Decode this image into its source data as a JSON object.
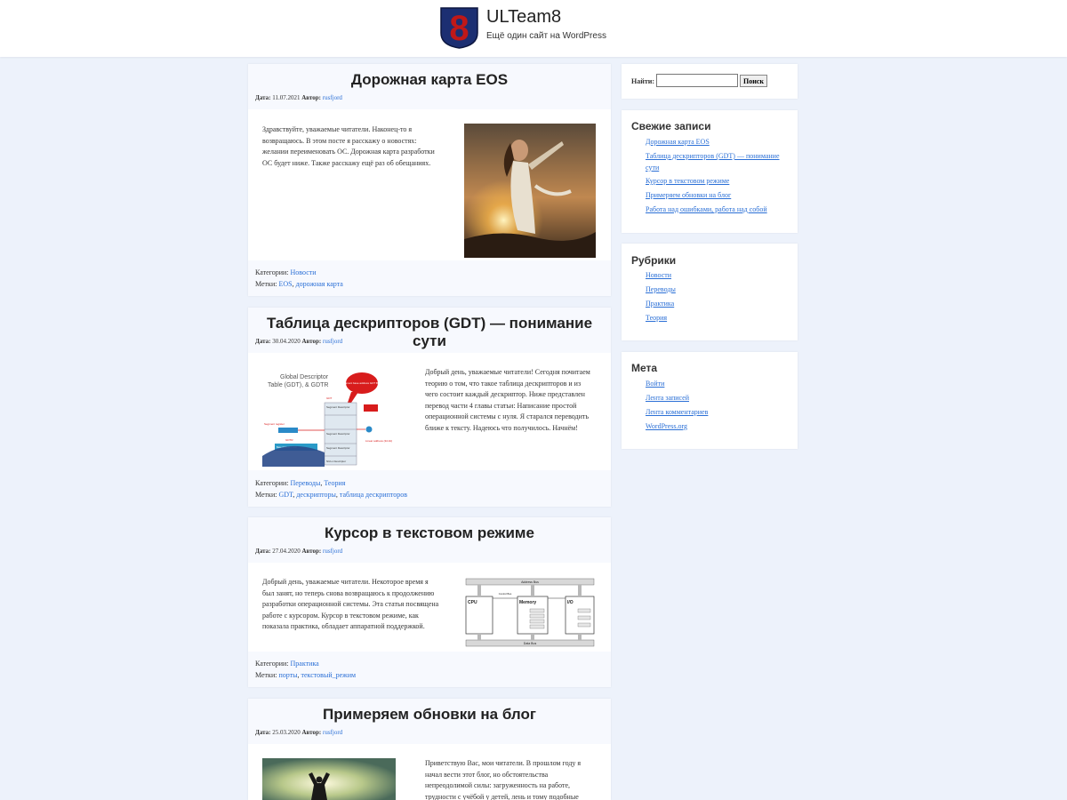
{
  "header": {
    "site_title": "ULTeam8",
    "site_description": "Ещё один сайт на WordPress",
    "logo_char": "8"
  },
  "labels": {
    "date": "Дата:",
    "author": "Автор:",
    "categories": "Категории:",
    "tags": "Метки:"
  },
  "posts": [
    {
      "title": "Дорожная карта EOS",
      "date": "11.07.2021",
      "author": "rusfjord",
      "excerpt": "Здравствуйте, уважаемые читатели. Наконец-то я возвращаюсь. В этом посте я расскажу о новостях: желании переименовать ОС. Дорожная карта разработки ОС будет ниже. Также расскажу ещё раз об обещаниях.",
      "categories": [
        "Новости"
      ],
      "tags": [
        "EOS",
        "дорожная карта"
      ]
    },
    {
      "title": "Таблица дескрипторов (GDT) — понимание сути",
      "date": "30.04.2020",
      "author": "rusfjord",
      "excerpt": "Добрый день, уважаемые читатели! Сегодня почитаем теорию о том, что такое таблица дескрипторов и из чего состоит каждый дескриптор. Ниже представлен перевод части 4 главы статьи: Написание простой операционной системы с нуля. Я старался переводить ближе к тексту. Надеюсь что получилось. Начнём!",
      "categories": [
        "Переводы",
        "Теория"
      ],
      "tags": [
        "GDT",
        "дескрипторы",
        "таблица дескрипторов"
      ],
      "diagram": {
        "title_line1": "Global Descriptor",
        "title_line2": "Table (GDT), & GDTR",
        "bubble": "Segment base address GDT Base",
        "gdt": "GDT",
        "gdtr": "GDTR",
        "segment_register": "Segment register",
        "segment_descriptor": "Segment Descriptor",
        "null_descriptor": "NULL Descriptor",
        "linear_address": "Linear address (32-bit)",
        "base_address": "Base Address | Limit",
        "offset": "Offset"
      }
    },
    {
      "title": "Курсор в текстовом режиме",
      "date": "27.04.2020",
      "author": "rusfjord",
      "excerpt": "Добрый день, уважаемые читатели. Некоторое время я был занят, но теперь снова возвращаюсь к продолжению разработки операционной системы. Эта статья посвящена работе с курсором. Курсор в текстовом режиме, как показала практика, обладает аппаратной поддержкой.",
      "categories": [
        "Практика"
      ],
      "tags": [
        "порты",
        "текстовый_режим"
      ],
      "diagram": {
        "address_bus": "Address Bus",
        "control_bus": "Control Bus",
        "data_bus": "Data Bus",
        "cpu": "CPU",
        "memory": "Memory",
        "io": "I/O"
      }
    },
    {
      "title": "Примеряем обновки на блог",
      "date": "25.03.2020",
      "author": "rusfjord",
      "excerpt": "Приветствую Вас, мои читатели. В прошлом году я начал вести этот блог, но обстоятельства непреодолимой силы: загруженность на работе, трудности с учёбой у детей, лень и тому подобные"
    }
  ],
  "sidebar": {
    "search": {
      "label": "Найти:",
      "value": "",
      "button": "Поиск"
    },
    "recent": {
      "title": "Свежие записи",
      "items": [
        "Дорожная карта EOS",
        "Таблица дескрипторов (GDT) — понимание сути",
        "Курсор в текстовом режиме",
        "Примеряем обновки на блог",
        "Работа над ошибками, работа над собой"
      ]
    },
    "categories": {
      "title": "Рубрики",
      "items": [
        "Новости",
        "Переводы",
        "Практика",
        "Теория"
      ]
    },
    "meta": {
      "title": "Мета",
      "items": [
        "Войти",
        "Лента записей",
        "Лента комментариев",
        "WordPress.org"
      ]
    }
  },
  "colors": {
    "page_bg": "#edf2fb",
    "card_bg": "#f7f9fe",
    "link": "#2a6fd6",
    "logo_blue": "#1c2f72",
    "logo_red": "#c01818"
  }
}
